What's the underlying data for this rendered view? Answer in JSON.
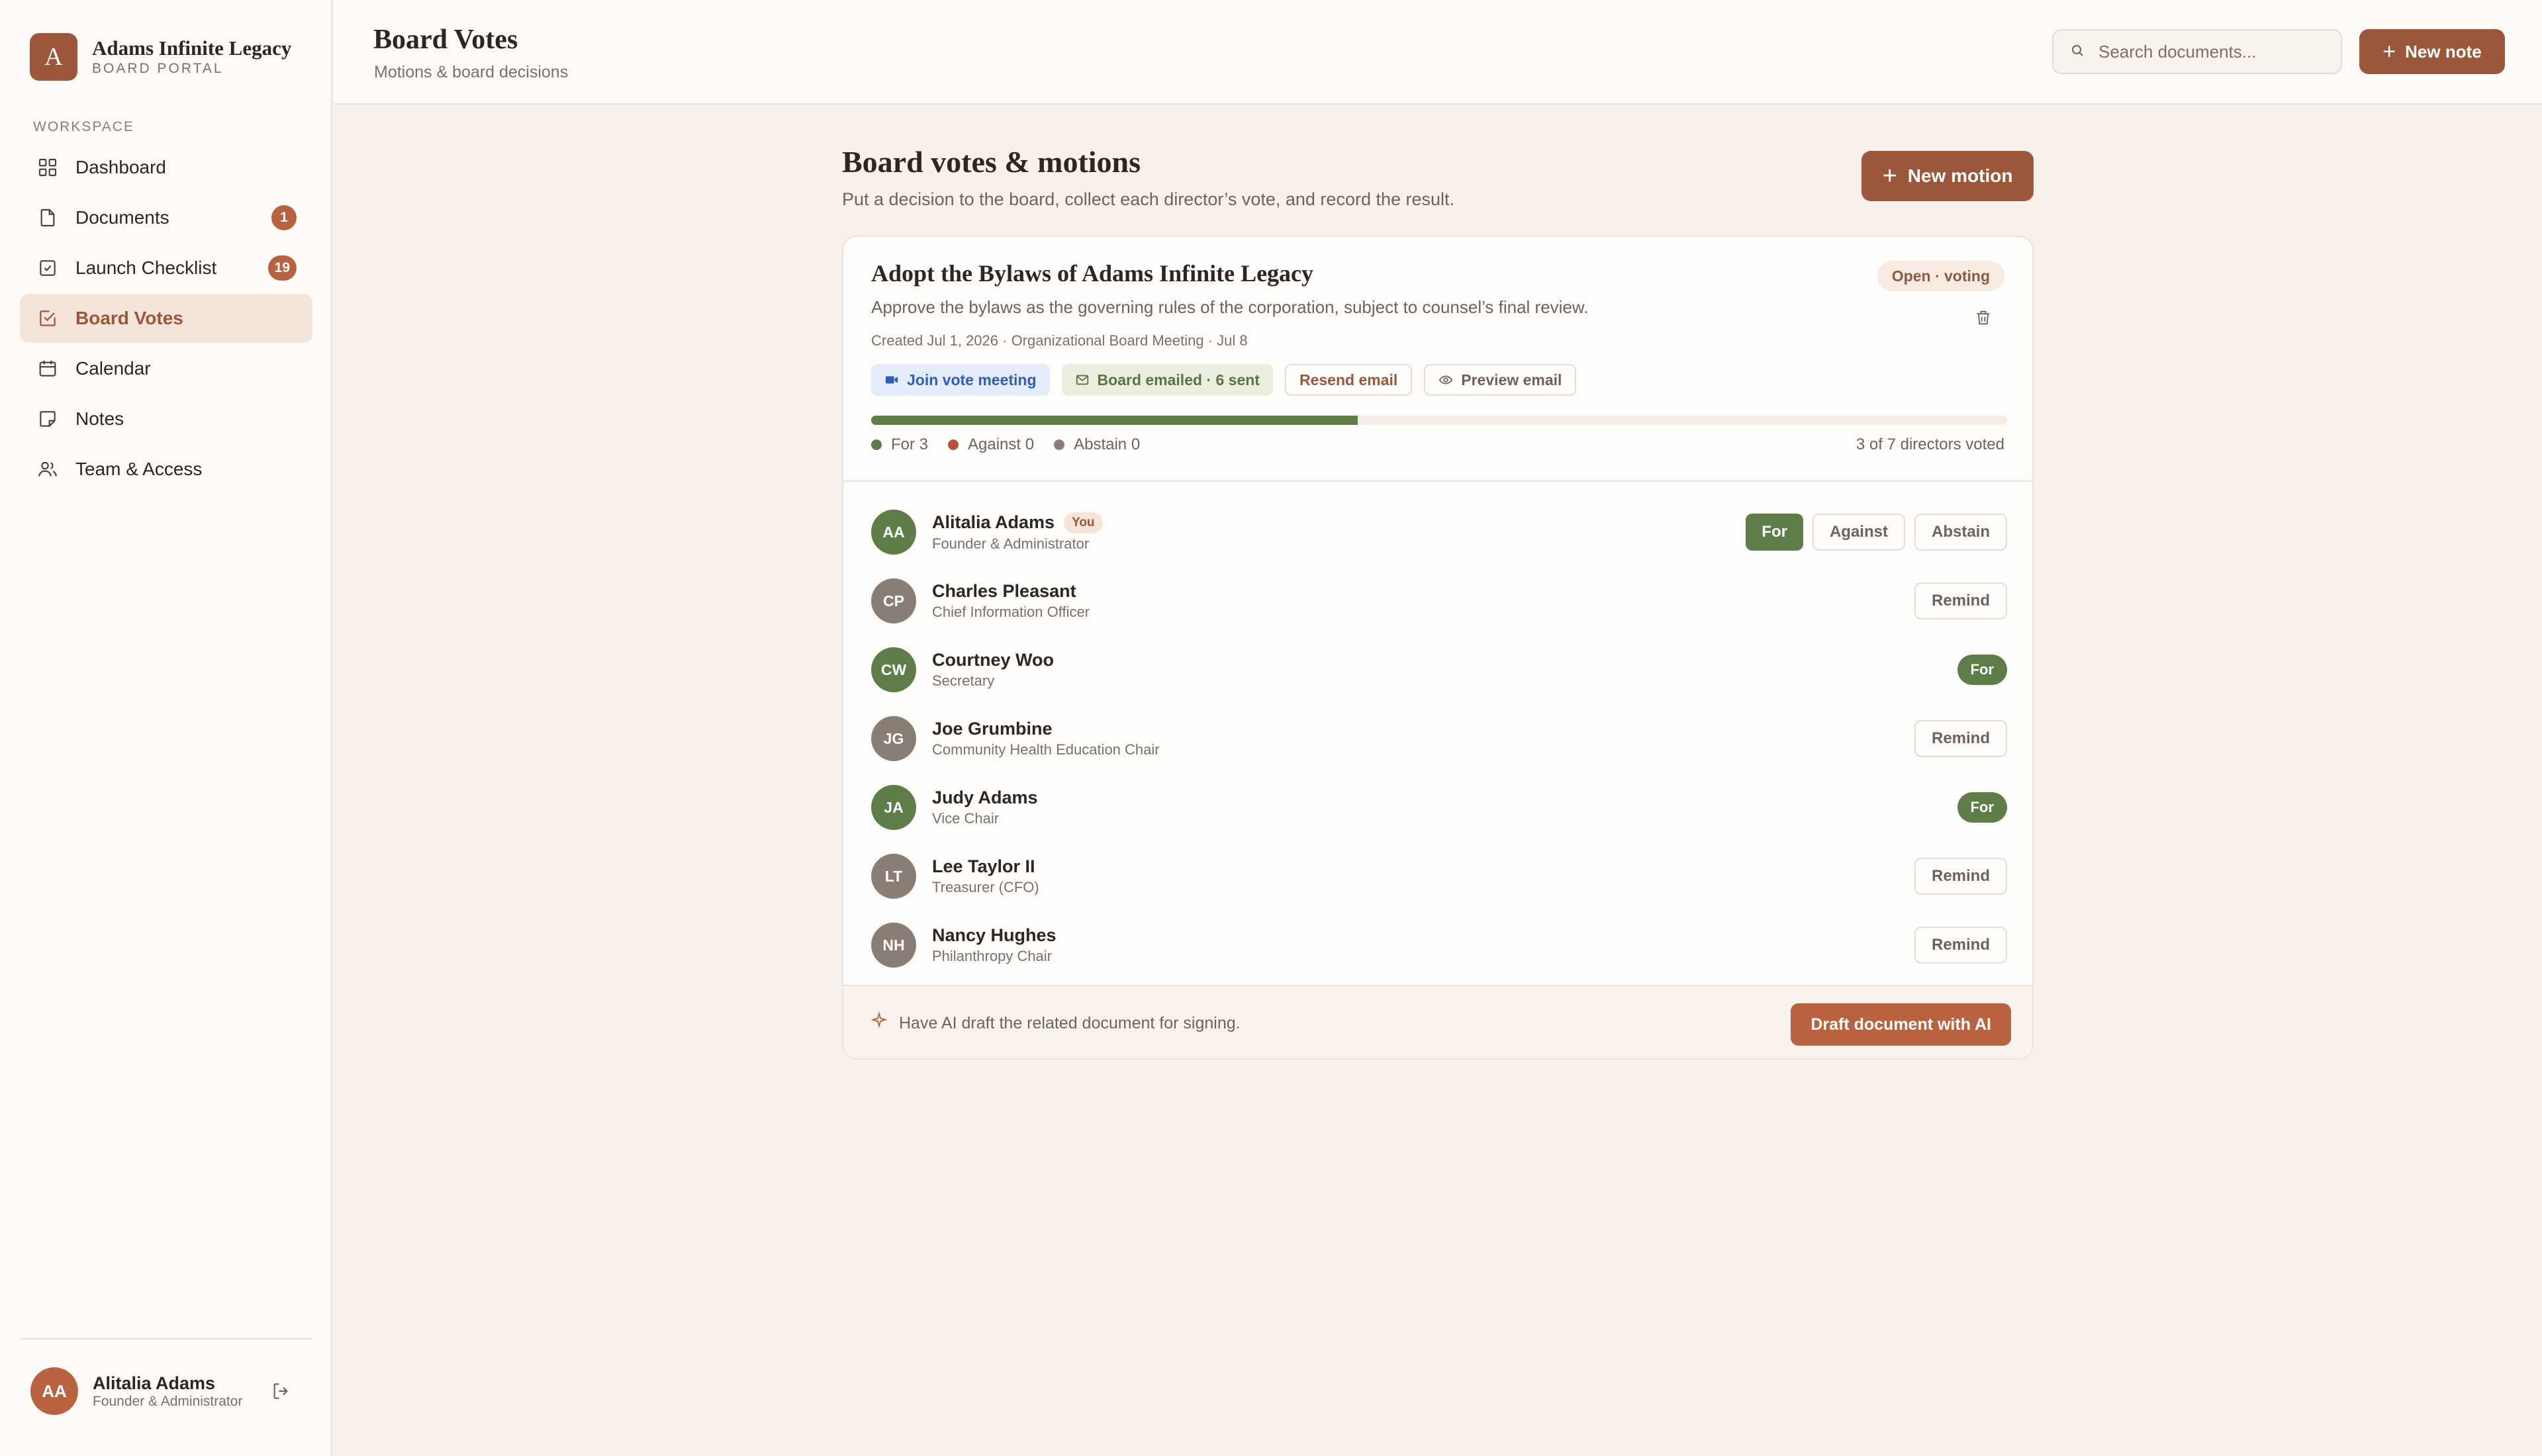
{
  "brand": {
    "initial": "A",
    "name": "Adams Infinite Legacy",
    "subtitle": "BOARD PORTAL"
  },
  "sidebar": {
    "section_label": "WORKSPACE",
    "items": [
      {
        "label": "Dashboard",
        "icon": "grid-icon"
      },
      {
        "label": "Documents",
        "icon": "file-icon",
        "badge": "1"
      },
      {
        "label": "Launch Checklist",
        "icon": "checkbox-icon",
        "badge": "19"
      },
      {
        "label": "Board Votes",
        "icon": "vote-icon",
        "active": true
      },
      {
        "label": "Calendar",
        "icon": "calendar-icon"
      },
      {
        "label": "Notes",
        "icon": "note-icon"
      },
      {
        "label": "Team & Access",
        "icon": "users-icon"
      }
    ],
    "user": {
      "initials": "AA",
      "name": "Alitalia Adams",
      "role": "Founder & Administrator"
    }
  },
  "header": {
    "title": "Board Votes",
    "subtitle": "Motions & board decisions",
    "search_placeholder": "Search documents...",
    "new_note_label": "New note"
  },
  "main": {
    "title": "Board votes & motions",
    "subtitle": "Put a decision to the board, collect each director’s vote, and record the result.",
    "new_motion_label": "New motion"
  },
  "motion": {
    "title": "Adopt the Bylaws of Adams Infinite Legacy",
    "status": "Open · voting",
    "description": "Approve the bylaws as the governing rules of the corporation, subject to counsel’s final review.",
    "meta": "Created Jul 1, 2026 · Organizational Board Meeting · Jul 8",
    "chips": {
      "join": "Join vote meeting",
      "emailed": "Board emailed · 6 sent",
      "resend": "Resend email",
      "preview": "Preview email"
    },
    "progress_fraction": 0.4286,
    "tally": {
      "for": "For 3",
      "against": "Against 0",
      "abstain": "Abstain 0"
    },
    "voted_summary": "3 of 7 directors voted",
    "you_tag": "You",
    "buttons": {
      "for": "For",
      "against": "Against",
      "abstain": "Abstain",
      "remind": "Remind"
    },
    "directors": [
      {
        "initials": "AA",
        "name": "Alitalia Adams",
        "role": "Founder & Administrator",
        "state": "self"
      },
      {
        "initials": "CP",
        "name": "Charles Pleasant",
        "role": "Chief Information Officer",
        "state": "pending"
      },
      {
        "initials": "CW",
        "name": "Courtney Woo",
        "role": "Secretary",
        "state": "for"
      },
      {
        "initials": "JG",
        "name": "Joe Grumbine",
        "role": "Community Health Education Chair",
        "state": "pending"
      },
      {
        "initials": "JA",
        "name": "Judy Adams",
        "role": "Vice Chair",
        "state": "for"
      },
      {
        "initials": "LT",
        "name": "Lee Taylor II",
        "role": "Treasurer (CFO)",
        "state": "pending"
      },
      {
        "initials": "NH",
        "name": "Nancy Hughes",
        "role": "Philanthropy Chair",
        "state": "pending"
      }
    ],
    "ai_prompt": "Have AI draft the related document for signing.",
    "ai_button": "Draft document with AI"
  },
  "colors": {
    "accent": "#9c573a",
    "for_green": "#5e7d48",
    "against_red": "#b5503a",
    "abstain_gray": "#8a7d75"
  }
}
